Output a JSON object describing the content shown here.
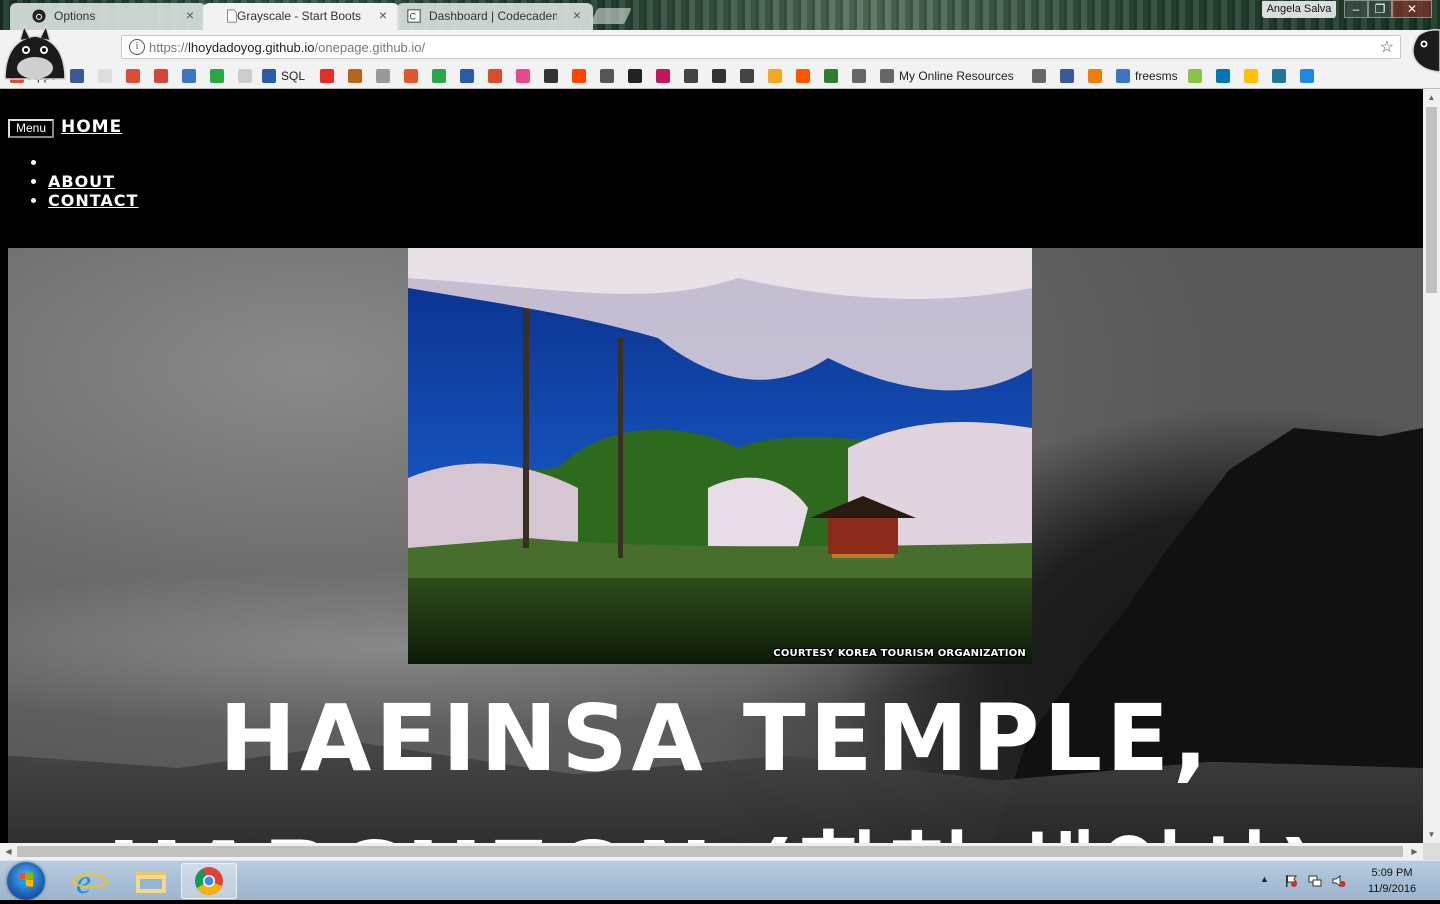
{
  "browser": {
    "tabs": [
      {
        "label": "Options",
        "close": "×",
        "active": false
      },
      {
        "label": "Grayscale - Start Bootstrap",
        "close": "×",
        "active": true
      },
      {
        "label": "Dashboard | Codecademy",
        "close": "×",
        "active": false
      }
    ],
    "user_name": "Angela Salva",
    "window_controls": {
      "minimize": "–",
      "restore": "❐",
      "close": "✕"
    },
    "address": {
      "prefix": "https://",
      "host": "lhoydadoyog.github.io",
      "path": "/onepage.github.io/",
      "info": "i",
      "star": "☆"
    },
    "bookmarks": [
      {
        "label": "Apps",
        "icon": "apps-grid-icon",
        "color": "#e54b2b"
      },
      {
        "label": "",
        "icon": "facebook-icon",
        "color": "#3b5998"
      },
      {
        "label": "",
        "icon": "google-icon",
        "color": "#dddddd"
      },
      {
        "label": "",
        "icon": "google-plus-icon",
        "color": "#dd4b39"
      },
      {
        "label": "",
        "icon": "gmail-icon",
        "color": "#d44638"
      },
      {
        "label": "",
        "icon": "bookmark-site-icon",
        "color": "#3a76c4"
      },
      {
        "label": "",
        "icon": "green-site-icon",
        "color": "#27a844"
      },
      {
        "label": "",
        "icon": "blank-page-icon",
        "color": "#cccccc"
      },
      {
        "label": "SQL",
        "icon": "sql-icon",
        "color": "#2a5aa8"
      },
      {
        "label": "",
        "icon": "youtube-icon",
        "color": "#e52d27"
      },
      {
        "label": "",
        "icon": "fox-site-icon",
        "color": "#b5651d"
      },
      {
        "label": "",
        "icon": "grid-site-icon",
        "color": "#999999"
      },
      {
        "label": "",
        "icon": "colorful-site-icon",
        "color": "#e3552b"
      },
      {
        "label": "",
        "icon": "tv-site-icon",
        "color": "#29a84a"
      },
      {
        "label": "",
        "icon": "globe-site-icon",
        "color": "#2a5aa8"
      },
      {
        "label": "",
        "icon": "film-site-icon",
        "color": "#d94c2b"
      },
      {
        "label": "",
        "icon": "k-site-icon",
        "color": "#e54b8c"
      },
      {
        "label": "",
        "icon": "dark-site-icon",
        "color": "#333333"
      },
      {
        "label": "",
        "icon": "reddit-icon",
        "color": "#ff4500"
      },
      {
        "label": "",
        "icon": "plant-site-icon",
        "color": "#555555"
      },
      {
        "label": "",
        "icon": "face-site-icon",
        "color": "#222222"
      },
      {
        "label": "",
        "icon": "m-site-icon",
        "color": "#c2185b"
      },
      {
        "label": "",
        "icon": "bug-site-icon",
        "color": "#444444"
      },
      {
        "label": "",
        "icon": "a-site-icon",
        "color": "#333333"
      },
      {
        "label": "",
        "icon": "circle-site-icon",
        "color": "#444444"
      },
      {
        "label": "",
        "icon": "w-site-icon",
        "color": "#f5a623"
      },
      {
        "label": "",
        "icon": "soundcloud-icon",
        "color": "#ff5500"
      },
      {
        "label": "",
        "icon": "book-site-icon",
        "color": "#2e7d32"
      },
      {
        "label": "",
        "icon": "phone-site-icon",
        "color": "#666666"
      },
      {
        "label": "My Online Resources",
        "icon": "folder-icon",
        "color": "#666666"
      },
      {
        "label": "",
        "icon": "phone2-site-icon",
        "color": "#666666"
      },
      {
        "label": "",
        "icon": "blue-site-icon",
        "color": "#3b5998"
      },
      {
        "label": "",
        "icon": "orange-site-icon",
        "color": "#f57c00"
      },
      {
        "label": "freesms",
        "icon": "sms-icon",
        "color": "#3a76c4"
      },
      {
        "label": "",
        "icon": "android-icon",
        "color": "#8bc34a"
      },
      {
        "label": "",
        "icon": "linkedin-icon",
        "color": "#0077b5"
      },
      {
        "label": "",
        "icon": "yellow-site-icon",
        "color": "#ffc107"
      },
      {
        "label": "",
        "icon": "wordpress-icon",
        "color": "#21759b"
      },
      {
        "label": "",
        "icon": "w-blue-site-icon",
        "color": "#1e88e5"
      }
    ]
  },
  "page": {
    "nav": {
      "menu_label": "Menu",
      "brand": "HOME",
      "items": [
        "",
        "ABOUT",
        "CONTACT"
      ]
    },
    "hero": {
      "photo_caption": "COURTESY KOREA TOURISM ORGANIZATION",
      "headline_line1": "HAEINSA TEMPLE,",
      "headline_line2": "HAPCHEON (합천 해인사)"
    }
  },
  "scrollbars": {
    "up": "▲",
    "down": "▼",
    "left": "◀",
    "right": "▶"
  },
  "taskbar": {
    "clock_time": "5:09 PM",
    "clock_date": "11/9/2016",
    "tray_arrow": "▲"
  }
}
